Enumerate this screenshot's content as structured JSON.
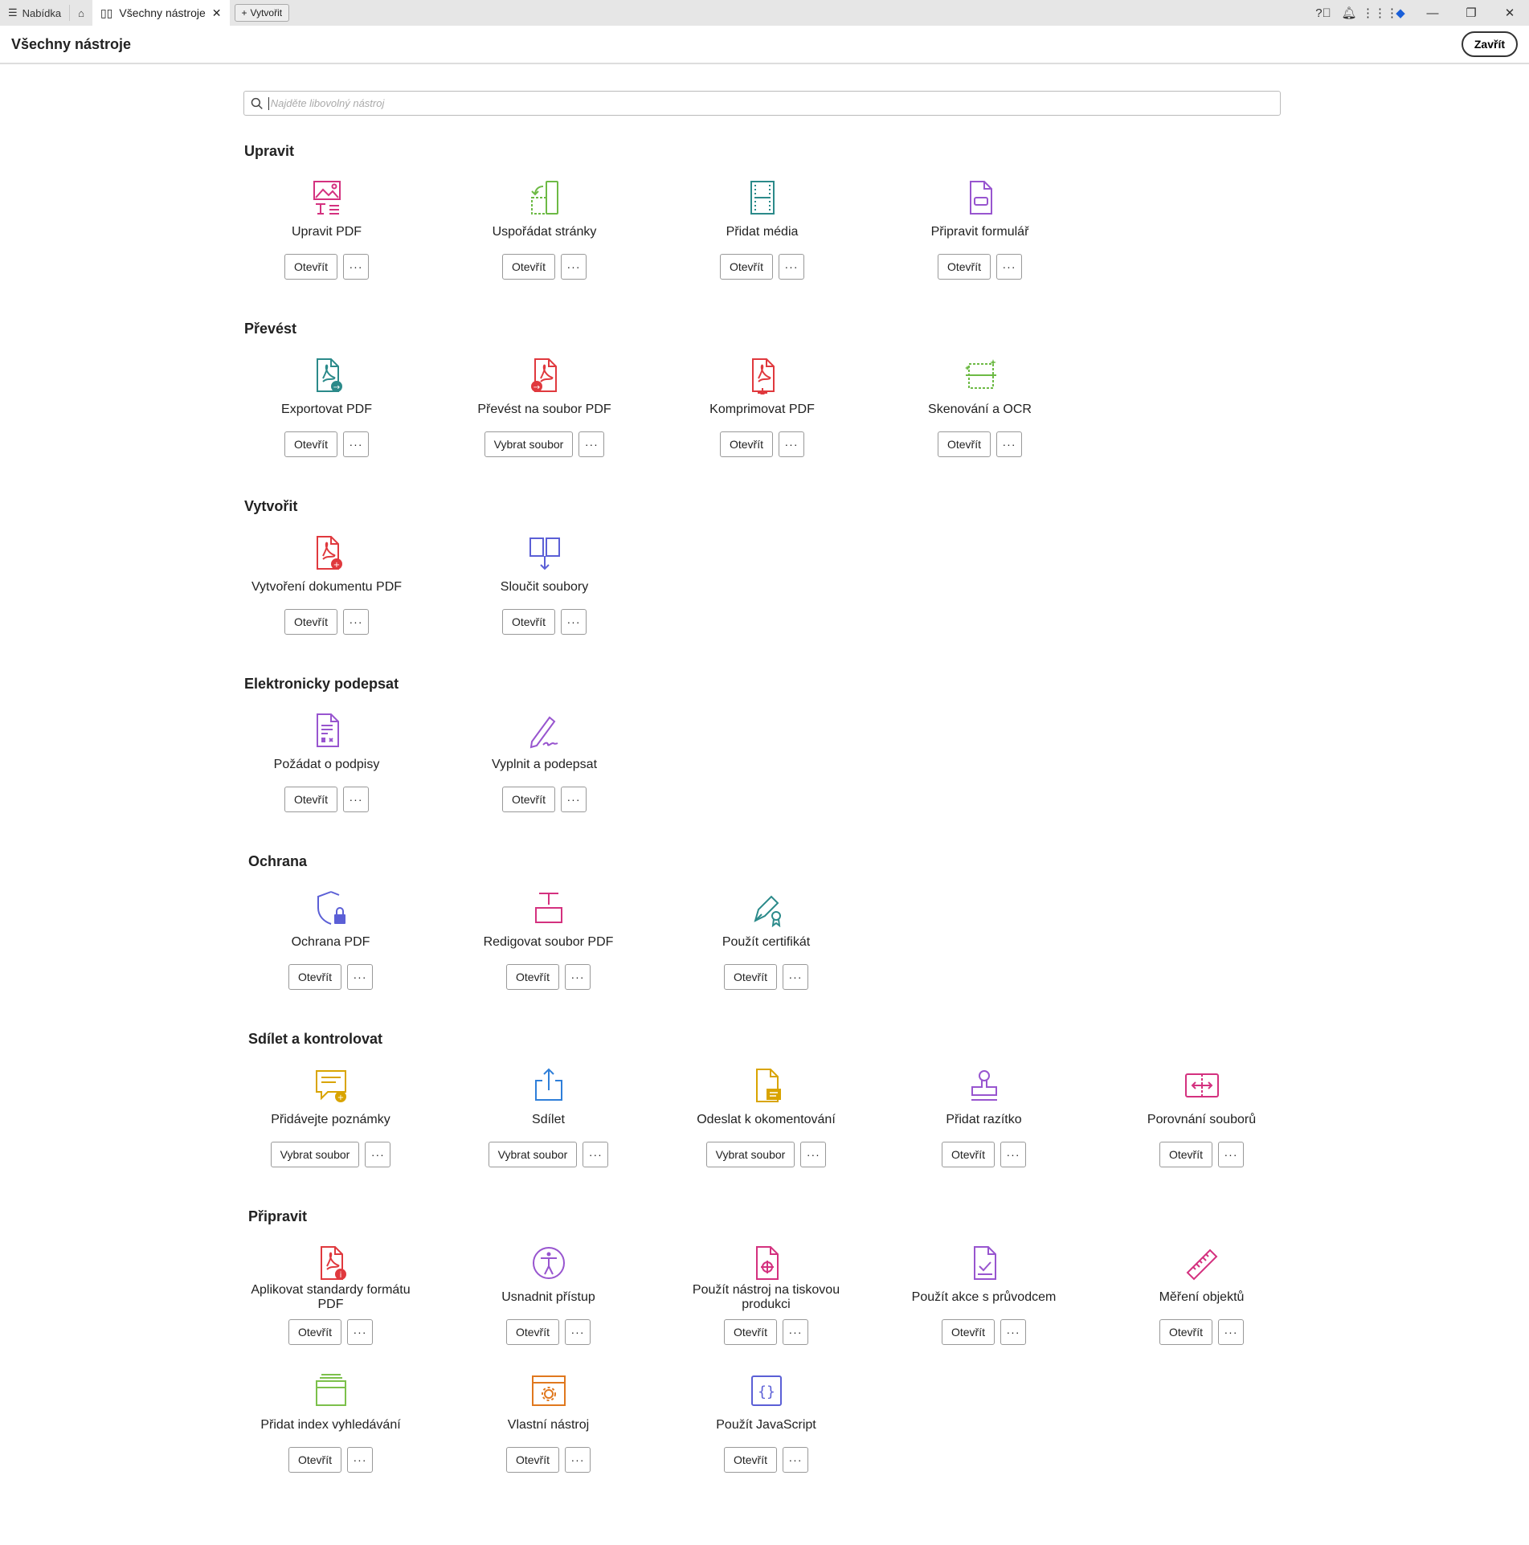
{
  "tabbar": {
    "menu": "Nabídka",
    "tab": "Všechny nástroje",
    "create": "Vytvořit"
  },
  "header": {
    "title": "Všechny nástroje",
    "close": "Zavřít"
  },
  "search": {
    "placeholder": "Najděte libovolný nástroj"
  },
  "more_label": "···",
  "colors": {
    "pink": "#d4317f",
    "green": "#6dba45",
    "teal": "#2b8a8a",
    "purple": "#9855cf",
    "red": "#e0393e",
    "indigo": "#5b5fd6",
    "orange": "#e0781e",
    "yellow": "#d9a400",
    "blue": "#2f7fd9",
    "lime": "#7cc04b"
  },
  "sections": [
    {
      "title": "Upravit",
      "tools": [
        {
          "label": "Upravit PDF",
          "button": "Otevřít",
          "icon": "edit-pdf-icon",
          "color": "pink"
        },
        {
          "label": "Uspořádat stránky",
          "button": "Otevřít",
          "icon": "organize-pages-icon",
          "color": "green"
        },
        {
          "label": "Přidat média",
          "button": "Otevřít",
          "icon": "add-media-icon",
          "color": "teal"
        },
        {
          "label": "Připravit formulář",
          "button": "Otevřít",
          "icon": "prepare-form-icon",
          "color": "purple"
        }
      ]
    },
    {
      "title": "Převést",
      "tools": [
        {
          "label": "Exportovat PDF",
          "button": "Otevřít",
          "icon": "export-pdf-icon",
          "color": "teal"
        },
        {
          "label": "Převést na soubor PDF",
          "button": "Vybrat soubor",
          "icon": "convert-pdf-icon",
          "color": "red"
        },
        {
          "label": "Komprimovat PDF",
          "button": "Otevřít",
          "icon": "compress-pdf-icon",
          "color": "red"
        },
        {
          "label": "Skenování a OCR",
          "button": "Otevřít",
          "icon": "scan-ocr-icon",
          "color": "green"
        }
      ]
    },
    {
      "title": "Vytvořit",
      "tools": [
        {
          "label": "Vytvoření dokumentu PDF",
          "button": "Otevřít",
          "icon": "create-pdf-icon",
          "color": "red"
        },
        {
          "label": "Sloučit soubory",
          "button": "Otevřít",
          "icon": "combine-files-icon",
          "color": "indigo"
        }
      ]
    },
    {
      "title": "Elektronicky podepsat",
      "tools": [
        {
          "label": "Požádat o podpisy",
          "button": "Otevřít",
          "icon": "request-signatures-icon",
          "color": "purple"
        },
        {
          "label": "Vyplnit a podepsat",
          "button": "Otevřít",
          "icon": "fill-sign-icon",
          "color": "purple"
        }
      ]
    },
    {
      "title": "Ochrana",
      "tools": [
        {
          "label": "Ochrana PDF",
          "button": "Otevřít",
          "icon": "protect-pdf-icon",
          "color": "indigo"
        },
        {
          "label": "Redigovat soubor PDF",
          "button": "Otevřít",
          "icon": "redact-icon",
          "color": "pink"
        },
        {
          "label": "Použít certifikát",
          "button": "Otevřít",
          "icon": "certificate-icon",
          "color": "teal"
        }
      ]
    },
    {
      "title": "Sdílet a kontrolovat",
      "tools": [
        {
          "label": "Přidávejte poznámky",
          "button": "Vybrat soubor",
          "icon": "comment-icon",
          "color": "yellow"
        },
        {
          "label": "Sdílet",
          "button": "Vybrat soubor",
          "icon": "share-icon",
          "color": "blue"
        },
        {
          "label": "Odeslat k okomentování",
          "button": "Vybrat soubor",
          "icon": "send-comment-icon",
          "color": "yellow"
        },
        {
          "label": "Přidat razítko",
          "button": "Otevřít",
          "icon": "stamp-icon",
          "color": "purple"
        },
        {
          "label": "Porovnání souborů",
          "button": "Otevřít",
          "icon": "compare-files-icon",
          "color": "pink"
        }
      ]
    },
    {
      "title": "Připravit",
      "tools": [
        {
          "label": "Aplikovat standardy formátu PDF",
          "button": "Otevřít",
          "icon": "pdf-standards-icon",
          "color": "red"
        },
        {
          "label": "Usnadnit přístup",
          "button": "Otevřít",
          "icon": "accessibility-icon",
          "color": "purple"
        },
        {
          "label": "Použít nástroj na tiskovou produkci",
          "button": "Otevřít",
          "icon": "print-production-icon",
          "color": "pink"
        },
        {
          "label": "Použít akce s průvodcem",
          "button": "Otevřít",
          "icon": "action-wizard-icon",
          "color": "purple"
        },
        {
          "label": "Měření objektů",
          "button": "Otevřít",
          "icon": "measure-icon",
          "color": "pink"
        },
        {
          "label": "Přidat index vyhledávání",
          "button": "Otevřít",
          "icon": "search-index-icon",
          "color": "lime"
        },
        {
          "label": "Vlastní nástroj",
          "button": "Otevřít",
          "icon": "custom-tool-icon",
          "color": "orange"
        },
        {
          "label": "Použít JavaScript",
          "button": "Otevřít",
          "icon": "javascript-icon",
          "color": "indigo"
        }
      ]
    }
  ]
}
